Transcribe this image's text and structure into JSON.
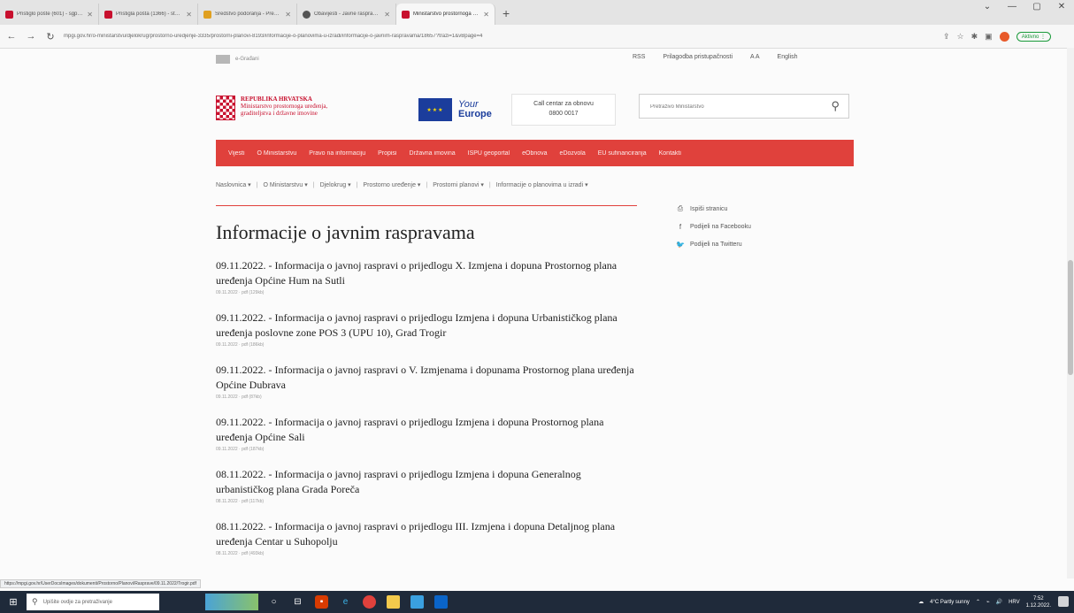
{
  "browser": {
    "tabs": [
      {
        "label": "Pristiglo pošte (601) - sgpevan...",
        "color": "#c8102e"
      },
      {
        "label": "Pristigla pošta (1366) - stal1801...",
        "color": "#c8102e"
      },
      {
        "label": "Sredstvo podoranja - Predmet...",
        "color": "#e0a020"
      },
      {
        "label": "Obavijesti - Javne rasprave u prip...",
        "color": "#555555"
      },
      {
        "label": "Ministarstvo prostornoga uređ...",
        "color": "#c8102e",
        "active": true
      }
    ],
    "new_tab": "+",
    "window_controls": [
      "⌄",
      "—",
      "▢",
      "✕"
    ],
    "url": "mpgi.gov.hr/o-ministarstvu/djelokrug/prostorno-uredjenje-3335/prostorni-planovi-8193/informacije-o-planovima-u-izradi/informacije-o-javnim-raspravama/18657?trazi=1&vBpage=4",
    "pause_label": "Aktivno ⋮"
  },
  "header": {
    "egradani": "e-Građani",
    "rss": "RSS",
    "accessibility": "Prilagodba pristupačnosti",
    "font_size": "A A",
    "english": "English",
    "logo_line1": "REPUBLIKA HRVATSKA",
    "logo_line2": "Ministarstvo prostornoga uređenja,",
    "logo_line3": "graditeljstva i državne imovine",
    "eu_line1": "Your",
    "eu_line2": "Europe",
    "call_label": "Call centar za obnovu",
    "call_number": "0800 0017",
    "search_placeholder": "Pretraživo Ministarstvo"
  },
  "nav": {
    "items": [
      "Vijesti",
      "O Ministarstvu",
      "Pravo na informaciju",
      "Propisi",
      "Državna imovina",
      "ISPU geoportal",
      "eObnova",
      "eDozvola",
      "EU sufinanciranja",
      "Kontakti"
    ]
  },
  "breadcrumb": [
    "Naslovnica ▾",
    "O Ministarstvu ▾",
    "Djelokrug ▾",
    "Prostorno uređenje ▾",
    "Prostorni planovi ▾",
    "Informacije o planovima u izradi ▾"
  ],
  "breadcrumb_sep": "|",
  "page": {
    "title": "Informacije o javnim raspravama"
  },
  "share": {
    "print": "Ispiši stranicu",
    "facebook": "Podijeli na Facebooku",
    "twitter": "Podijeli na Twitteru"
  },
  "items": [
    {
      "title": "09.11.2022. - Informacija o javnoj raspravi o prijedlogu X. Izmjena i dopuna Prostornog plana uređenja Općine Hum na Sutli",
      "meta": "09.11.2022 · pdf (129kb)"
    },
    {
      "title": "09.11.2022. - Informacija o javnoj raspravi o prijedlogu Izmjena i dopuna Urbanističkog plana uređenja poslovne zone POS 3 (UPU 10), Grad Trogir",
      "meta": "09.11.2022 · pdf (186kb)"
    },
    {
      "title": "09.11.2022. - Informacija o javnoj raspravi o V. Izmjenama i dopunama Prostornog plana uređenja Općine Dubrava",
      "meta": "09.11.2022 · pdf (87kb)"
    },
    {
      "title": "09.11.2022. - Informacija o javnoj raspravi o prijedlogu Izmjena i dopuna Prostornog plana uređenja Općine Sali",
      "meta": "09.11.2022 · pdf (187kb)"
    },
    {
      "title": "08.11.2022. - Informacija o javnoj raspravi o prijedlogu Izmjena i dopuna Generalnog urbanističkog plana Grada Poreča",
      "meta": "08.11.2022 · pdf (117kb)"
    },
    {
      "title": "08.11.2022. - Informacija o javnoj raspravi o prijedlogu III. Izmjena i dopuna Detaljnog plana uređenja Centar u Suhopolju",
      "meta": "08.11.2022 · pdf (493kb)"
    }
  ],
  "status_url": "https://mpgi.gov.hr/UserDocsImages/dokumenti/Prostorno/Planovi/Rasprave/09.11.2022/Trogir.pdf",
  "taskbar": {
    "search_placeholder": "Upišite ovdje za pretraživanje",
    "weather": "4°C Partly sunny",
    "lang": "HRV",
    "time": "7:52",
    "date": "1.12.2022."
  },
  "colors": {
    "accent": "#e0413c",
    "brand_red": "#c8102e",
    "eu_blue": "#1b3d9c"
  }
}
